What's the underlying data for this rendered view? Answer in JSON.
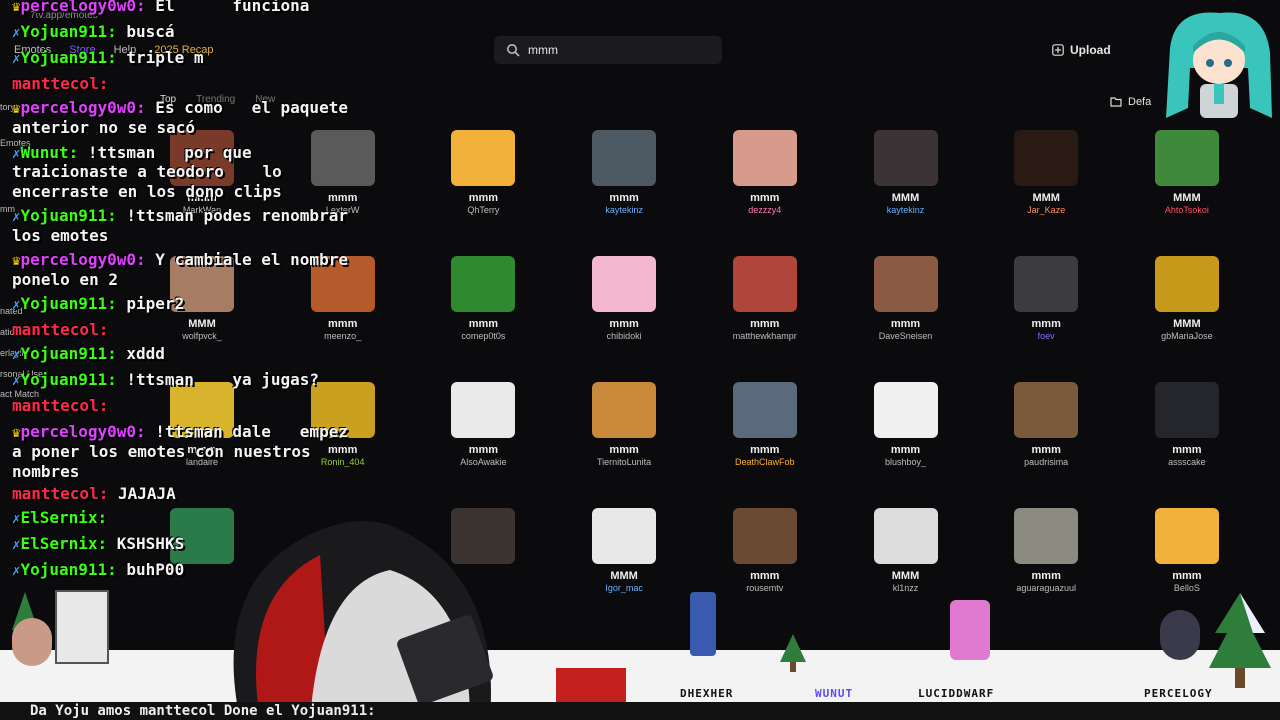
{
  "browser": {
    "url": "7tv.app/emotes"
  },
  "nav": [
    "Emotes",
    "Store",
    "Help",
    "2025 Recap"
  ],
  "search": {
    "query": "mmm"
  },
  "header": {
    "upload_label": "Upload",
    "default_label": "Defa"
  },
  "sort_tabs": [
    "Top",
    "Trending",
    "New"
  ],
  "sidebar_labels": [
    "tory",
    "Emotes",
    "mm",
    "nated",
    "atic",
    "erlayin",
    "rsonal Use",
    "act Match"
  ],
  "emotes": [
    {
      "name": "mmm",
      "author": "MarkWan",
      "author_color": "#bdbdbd",
      "bg": "#7a3a2a"
    },
    {
      "name": "mmm",
      "author": "LexterW",
      "author_color": "#bdbdbd",
      "bg": "#5a5a5a"
    },
    {
      "name": "mmm",
      "author": "QhTerry",
      "author_color": "#bdbdbd",
      "bg": "#f2b13b"
    },
    {
      "name": "mmm",
      "author": "kaytekinz",
      "author_color": "#6ab0ff",
      "bg": "#4d5a63"
    },
    {
      "name": "mmm",
      "author": "dezzzy4",
      "author_color": "#ff7ab6",
      "bg": "#d89a8a"
    },
    {
      "name": "MMM",
      "author": "kaytekinz",
      "author_color": "#6ab0ff",
      "bg": "#3b3336"
    },
    {
      "name": "MMM",
      "author": "Jar_Kaze",
      "author_color": "#ff8c5a",
      "bg": "#2a1a14"
    },
    {
      "name": "MMM",
      "author": "AhtoTsokoi",
      "author_color": "#ff4d6a",
      "bg": "#3f8a3a"
    },
    {
      "name": "MMM",
      "author": "wolfpvck_",
      "author_color": "#bdbdbd",
      "bg": "#a67c63"
    },
    {
      "name": "mmm",
      "author": "meenzo_",
      "author_color": "#bdbdbd",
      "bg": "#b55a2a"
    },
    {
      "name": "mmm",
      "author": "comep0t0s",
      "author_color": "#bdbdbd",
      "bg": "#2f8a2f"
    },
    {
      "name": "mmm",
      "author": "chibidoki",
      "author_color": "#bdbdbd",
      "bg": "#f3b7cf"
    },
    {
      "name": "mmm",
      "author": "matthewkhampr",
      "author_color": "#bdbdbd",
      "bg": "#b0453b"
    },
    {
      "name": "mmm",
      "author": "DaveSneisen",
      "author_color": "#bdbdbd",
      "bg": "#8a5a42"
    },
    {
      "name": "mmm",
      "author": "foev",
      "author_color": "#8a6cff",
      "bg": "#3c3c40"
    },
    {
      "name": "MMM",
      "author": "gbMariaJose",
      "author_color": "#bdbdbd",
      "bg": "#c79a1c"
    },
    {
      "name": "mmm",
      "author": "landaire",
      "author_color": "#bdbdbd",
      "bg": "#d8b42c"
    },
    {
      "name": "mmm",
      "author": "Ronin_404",
      "author_color": "#9acd32",
      "bg": "#c9a020"
    },
    {
      "name": "mmm",
      "author": "AlsoAwakie",
      "author_color": "#bdbdbd",
      "bg": "#eaeaea"
    },
    {
      "name": "mmm",
      "author": "TiernitoLunita",
      "author_color": "#bdbdbd",
      "bg": "#c8893a"
    },
    {
      "name": "mmm",
      "author": "DeathClawFob",
      "author_color": "#ffb020",
      "bg": "#5a6a7c"
    },
    {
      "name": "mmm",
      "author": "blushboy_",
      "author_color": "#bdbdbd",
      "bg": "#f0f0f0"
    },
    {
      "name": "mmm",
      "author": "paudrisima",
      "author_color": "#bdbdbd",
      "bg": "#7a5a3a"
    },
    {
      "name": "mmm",
      "author": "assscake",
      "author_color": "#bdbdbd",
      "bg": "#24262b"
    },
    {
      "name": "",
      "author": "",
      "author_color": "#bdbdbd",
      "bg": "#2a7a4a"
    },
    {
      "name": "",
      "author": "",
      "author_color": "#bdbdbd",
      "bg": "#0b0b0d"
    },
    {
      "name": "",
      "author": "",
      "author_color": "#bdbdbd",
      "bg": "#3a3330"
    },
    {
      "name": "MMM",
      "author": "Igor_mac",
      "author_color": "#6ab0ff",
      "bg": "#e8e8e8"
    },
    {
      "name": "mmm",
      "author": "rousemtv",
      "author_color": "#bdbdbd",
      "bg": "#6a4a32"
    },
    {
      "name": "MMM",
      "author": "kl1nzz",
      "author_color": "#bdbdbd",
      "bg": "#dcdcdc"
    },
    {
      "name": "mmm",
      "author": "aguaraguazuul",
      "author_color": "#bdbdbd",
      "bg": "#8a8a80"
    },
    {
      "name": "mmm",
      "author": "BelloS",
      "author_color": "#bdbdbd",
      "bg": "#f2b13b"
    }
  ],
  "chat": [
    {
      "prefix": "crown",
      "user": "percelogy0w0:",
      "text": " El      funciona"
    },
    {
      "prefix": "badge",
      "user": "Yojuan911:",
      "text": " buscá"
    },
    {
      "prefix": "badge",
      "user": "Yojuan911:",
      "text": " triple m"
    },
    {
      "prefix": "",
      "user": "manttecol:",
      "text": ""
    },
    {
      "prefix": "crown",
      "user": "percelogy0w0:",
      "text": " Es como   el paquete"
    },
    {
      "prefix": "",
      "user": "",
      "text": "anterior no se sacó"
    },
    {
      "prefix": "badge",
      "user": "Wunut:",
      "text": " !ttsman   por que"
    },
    {
      "prefix": "",
      "user": "",
      "text": "traicionaste a teodoro    lo"
    },
    {
      "prefix": "",
      "user": "",
      "text": "encerraste en los dono clips"
    },
    {
      "prefix": "badge",
      "user": "Yojuan911:",
      "text": " !ttsman podes renombrar"
    },
    {
      "prefix": "",
      "user": "",
      "text": "los emotes"
    },
    {
      "prefix": "crown",
      "user": "percelogy0w0:",
      "text": " Y cambiale el nombre"
    },
    {
      "prefix": "",
      "user": "",
      "text": "ponelo en 2"
    },
    {
      "prefix": "badge",
      "user": "Yojuan911:",
      "text": " piper2"
    },
    {
      "prefix": "",
      "user": "manttecol:",
      "text": ""
    },
    {
      "prefix": "badge",
      "user": "Yojuan911:",
      "text": " xddd"
    },
    {
      "prefix": "badge",
      "user": "Yojuan911:",
      "text": " !ttsman    ya jugas?"
    },
    {
      "prefix": "",
      "user": "manttecol:",
      "text": ""
    },
    {
      "prefix": "crown",
      "user": "percelogy0w0:",
      "text": " !ttsman dale   empez"
    },
    {
      "prefix": "",
      "user": "",
      "text": "a poner los emotes con nuestros"
    },
    {
      "prefix": "",
      "user": "",
      "text": "nombres"
    },
    {
      "prefix": "",
      "user": "manttecol:",
      "text": " JAJAJA"
    },
    {
      "prefix": "badge",
      "user": "ElSernix:",
      "text": ""
    },
    {
      "prefix": "badge",
      "user": "ElSernix:",
      "text": " KSHSHKS"
    },
    {
      "prefix": "badge",
      "user": "Yojuan911:",
      "text": " buhP00"
    }
  ],
  "game_names": [
    "DHEXHER",
    "WUNUT",
    "LUCIDDWARF",
    "PERCELOGY"
  ],
  "ticker": "Da  Yoju  amos manttecol  Done el   Yojuan911:"
}
